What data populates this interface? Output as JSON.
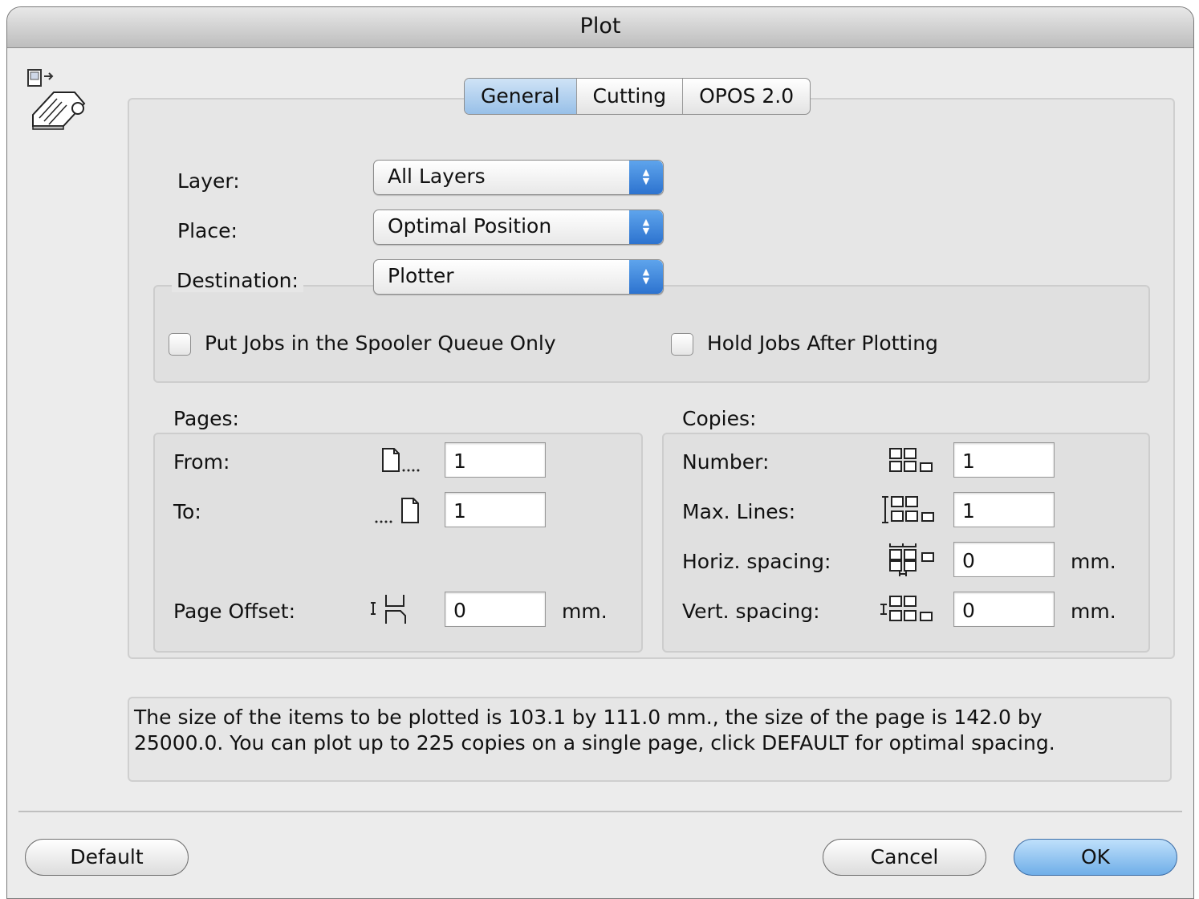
{
  "window": {
    "title": "Plot"
  },
  "tabs": [
    {
      "label": "General",
      "active": true
    },
    {
      "label": "Cutting",
      "active": false
    },
    {
      "label": "OPOS 2.0",
      "active": false
    }
  ],
  "general": {
    "layer": {
      "label": "Layer:",
      "value": "All Layers"
    },
    "place": {
      "label": "Place:",
      "value": "Optimal Position"
    },
    "destination": {
      "label": "Destination:",
      "value": "Plotter"
    },
    "checkboxes": {
      "spooler": {
        "label": "Put Jobs in the Spooler Queue Only",
        "checked": false
      },
      "hold": {
        "label": "Hold Jobs After Plotting",
        "checked": false
      }
    }
  },
  "pages": {
    "title": "Pages:",
    "from": {
      "label": "From:",
      "value": "1"
    },
    "to": {
      "label": "To:",
      "value": "1"
    },
    "offset": {
      "label": "Page Offset:",
      "value": "0",
      "unit": "mm."
    }
  },
  "copies": {
    "title": "Copies:",
    "number": {
      "label": "Number:",
      "value": "1"
    },
    "max_lines": {
      "label": "Max. Lines:",
      "value": "1"
    },
    "horiz_spacing": {
      "label": "Horiz. spacing:",
      "value": "0",
      "unit": "mm."
    },
    "vert_spacing": {
      "label": "Vert. spacing:",
      "value": "0",
      "unit": "mm."
    }
  },
  "info": {
    "line1": "The size of the items to be plotted is 103.1 by 111.0 mm., the size of the page is 142.0 by",
    "line2": "25000.0. You can plot up to 225 copies on a single page, click DEFAULT for optimal spacing."
  },
  "buttons": {
    "default": "Default",
    "cancel": "Cancel",
    "ok": "OK"
  },
  "colors": {
    "accent": "#4a90e2",
    "window_bg": "#ececec"
  },
  "icons": {
    "app": "plotter-icon",
    "from": "page-dots-icon",
    "to": "dots-page-icon",
    "offset": "page-offset-icon",
    "number": "copies-grid-icon",
    "max_lines": "max-lines-grid-icon",
    "horiz": "horizontal-spacing-icon",
    "vert": "vertical-spacing-icon"
  }
}
